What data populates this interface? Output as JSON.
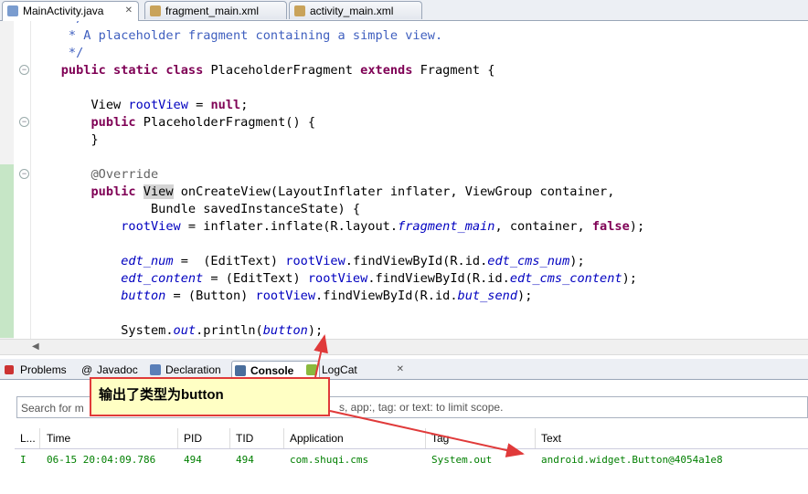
{
  "editor_tabs": [
    {
      "label": "MainActivity.java",
      "close": "✕"
    },
    {
      "label": "fragment_main.xml"
    },
    {
      "label": "activity_main.xml"
    }
  ],
  "code": {
    "l1_comment": "     * A placeholder fragment containing a simple view.",
    "l2_comment": "     */",
    "l3": {
      "kw1": "public",
      "kw2": "static",
      "kw3": "class",
      "name": "PlaceholderFragment",
      "kw4": "extends",
      "rest": "Fragment {"
    },
    "l4": {
      "type": "View",
      "var": "rootView",
      "eq": " = ",
      "kw": "null",
      "end": ";"
    },
    "l5": {
      "kw": "public",
      "rest": " PlaceholderFragment() {"
    },
    "l6": "}",
    "l7_annotation": "@Override",
    "l8": {
      "kw": "public",
      "type": "View",
      "rest": " onCreateView(LayoutInflater inflater, ViewGroup container,"
    },
    "l9": "Bundle savedInstanceState) {",
    "l10": {
      "var": "rootView",
      "a": " = inflater.inflate(R.layout.",
      "layout": "fragment_main",
      "b": ", container, ",
      "kw": "false",
      "c": ");"
    },
    "l11": {
      "var": "edt_num",
      "a": " =  (EditText) ",
      "rv": "rootView",
      "b": ".findViewById(R.id.",
      "id": "edt_cms_num",
      "c": ");"
    },
    "l12": {
      "var": "edt_content",
      "a": " = (EditText) ",
      "rv": "rootView",
      "b": ".findViewById(R.id.",
      "id": "edt_cms_content",
      "c": ");"
    },
    "l13": {
      "var": "button",
      "a": " = (Button) ",
      "rv": "rootView",
      "b": ".findViewById(R.id.",
      "id": "but_send",
      "c": ");"
    },
    "l14": {
      "a": "System.",
      "out": "out",
      "b": ".println(",
      "var": "button",
      "c": ");"
    }
  },
  "view_tabs": [
    {
      "label": "Problems",
      "icon": "problems-icon"
    },
    {
      "label": "Javadoc",
      "icon": "javadoc-icon"
    },
    {
      "label": "Declaration",
      "icon": "declaration-icon"
    },
    {
      "label": "Console",
      "icon": "console-icon"
    },
    {
      "label": "LogCat",
      "icon": "logcat-icon"
    }
  ],
  "logcat": {
    "search_placeholder": "Search for m",
    "search_hint_tail": "s, app:, tag: or text: to limit scope.",
    "columns": [
      "L...",
      "Time",
      "PID",
      "TID",
      "Application",
      "Tag",
      "Text"
    ],
    "rows": [
      {
        "level": "I",
        "time": "06-15 20:04:09.786",
        "pid": "494",
        "tid": "494",
        "app": "com.shuqi.cms",
        "tag": "System.out",
        "text": "android.widget.Button@4054a1e8"
      }
    ]
  },
  "callout": {
    "text": "输出了类型为button"
  },
  "colors": {
    "callout_border": "#e03a3a",
    "callout_bg": "#ffffc4",
    "log_info": "#007f00",
    "keyword": "#7f0055",
    "field": "#0000c0",
    "comment": "#3f5fbf"
  }
}
